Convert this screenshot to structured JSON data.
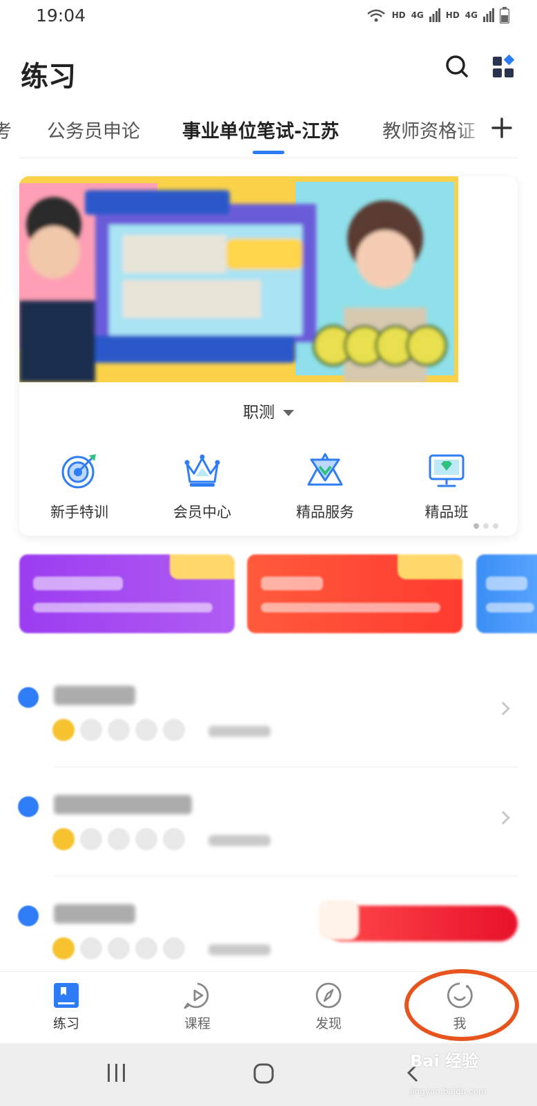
{
  "status_bar": {
    "time": "19:04",
    "indicators": [
      "HD",
      "4G",
      "HD",
      "4G"
    ]
  },
  "header": {
    "title": "练习",
    "search_icon": "search-icon",
    "apps_icon": "apps-grid-icon"
  },
  "tabs": {
    "items": [
      {
        "label": "考"
      },
      {
        "label": "公务员申论"
      },
      {
        "label": "事业单位笔试-江苏"
      },
      {
        "label": "教师资格证"
      }
    ],
    "active_index": 2,
    "add_icon": "plus-icon"
  },
  "main_card": {
    "subject": "职测",
    "quick_links": [
      {
        "label": "新手特训",
        "icon": "target-icon"
      },
      {
        "label": "会员中心",
        "icon": "crown-icon"
      },
      {
        "label": "精品服务",
        "icon": "diamond-icon"
      },
      {
        "label": "精品班",
        "icon": "monitor-icon"
      }
    ]
  },
  "bottom_nav": {
    "items": [
      {
        "label": "练习",
        "icon": "book-icon"
      },
      {
        "label": "课程",
        "icon": "play-icon"
      },
      {
        "label": "发现",
        "icon": "compass-icon"
      },
      {
        "label": "我",
        "icon": "profile-icon"
      }
    ],
    "active_index": 0
  },
  "colors": {
    "accent": "#2b7cf6",
    "highlight": "#e8541d",
    "promo_purple": "#9b3df0",
    "promo_red": "#ff4a3a",
    "promo_blue": "#3b8ef5"
  },
  "watermark": {
    "brand": "Bai 经验",
    "url": "jingyan.baidu.com"
  }
}
